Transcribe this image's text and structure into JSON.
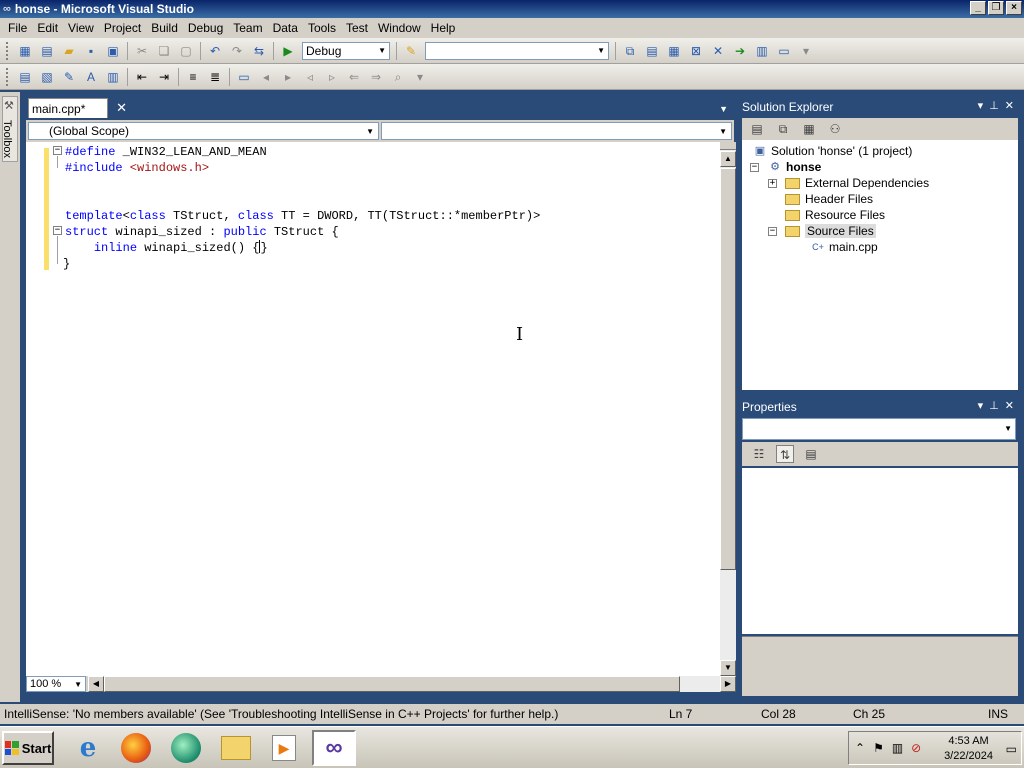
{
  "window": {
    "title": "honse - Microsoft Visual Studio"
  },
  "menu": [
    "File",
    "Edit",
    "View",
    "Project",
    "Build",
    "Debug",
    "Team",
    "Data",
    "Tools",
    "Test",
    "Window",
    "Help"
  ],
  "toolbar": {
    "config": "Debug",
    "find_box": ""
  },
  "toolbox": {
    "label": "Toolbox"
  },
  "editor": {
    "tab_label": "main.cpp*",
    "scope_left": "(Global Scope)",
    "scope_right": "",
    "zoom": "100 %",
    "code": {
      "l1a": "#define",
      "l1b": " _WIN32_LEAN_AND_MEAN",
      "l2a": "#include",
      "l2b": " <windows.h>",
      "l5a": "template",
      "l5b": "<",
      "l5c": "class",
      "l5d": " TStruct, ",
      "l5e": "class",
      "l5f": " TT = DWORD, TT(TStruct::*memberPtr)>",
      "l6a": "struct",
      "l6b": " winapi_sized : ",
      "l6c": "public",
      "l6d": " TStruct {",
      "l7a": "    ",
      "l7b": "inline",
      "l7c": " winapi_sized() {",
      "l7d": "}",
      "l8": "}"
    }
  },
  "solution_explorer": {
    "title": "Solution Explorer",
    "solution": "Solution 'honse' (1 project)",
    "project": "honse",
    "items": [
      "External Dependencies",
      "Header Files",
      "Resource Files",
      "Source Files"
    ],
    "file": "main.cpp"
  },
  "properties": {
    "title": "Properties"
  },
  "status": {
    "message": "IntelliSense: 'No members available' (See 'Troubleshooting IntelliSense in C++ Projects' for further help.)",
    "line": "Ln 7",
    "col": "Col 28",
    "ch": "Ch 25",
    "mode": "INS"
  },
  "taskbar": {
    "start": "Start",
    "time": "4:53 AM",
    "date": "3/22/2024"
  },
  "colors": {
    "keyword": "#0000ff",
    "string": "#a31515",
    "panel_bg": "#2a4a78"
  }
}
